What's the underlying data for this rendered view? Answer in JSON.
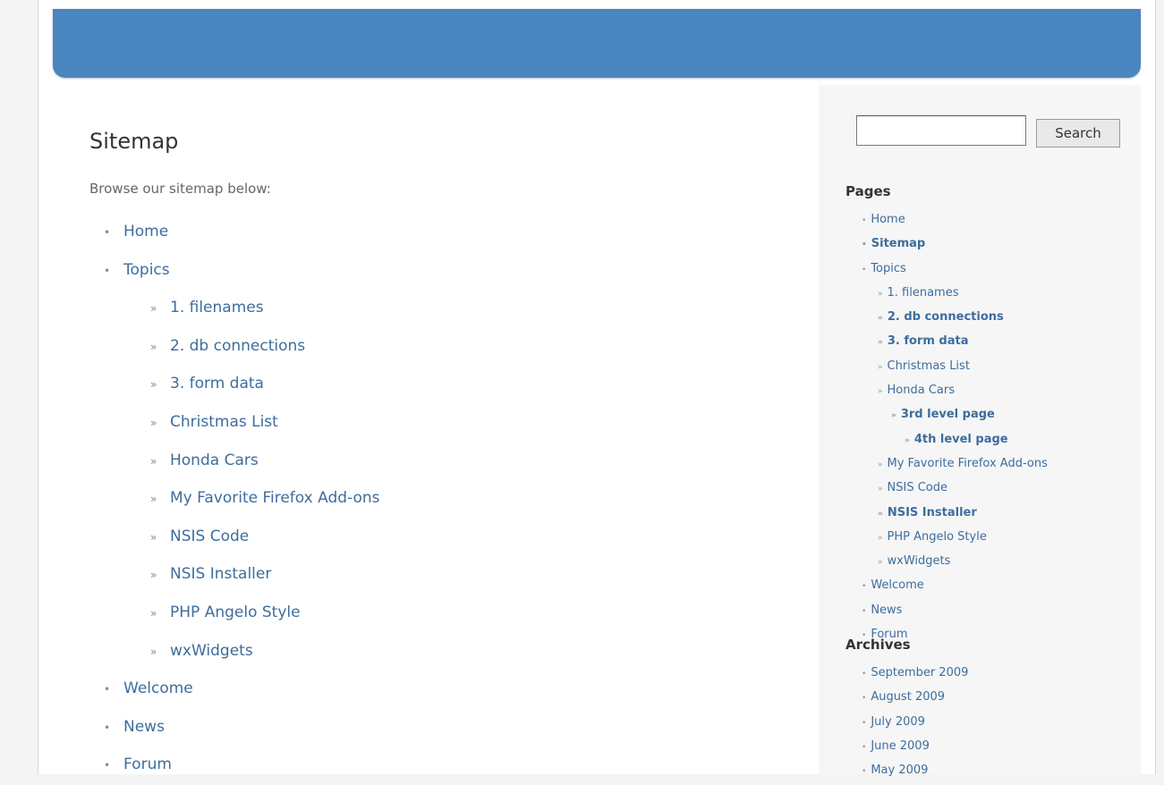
{
  "page": {
    "title": "Sitemap",
    "intro": "Browse our sitemap below:"
  },
  "search": {
    "value": "",
    "button_label": "Search"
  },
  "sitemap": {
    "top": [
      "Home",
      "Topics"
    ],
    "topics_children": [
      "1. filenames",
      "2. db connections",
      "3. form data",
      "Christmas List",
      "Honda Cars",
      "My Favorite Firefox Add-ons",
      "NSIS Code",
      "NSIS Installer",
      "PHP Angelo Style",
      "wxWidgets"
    ],
    "bottom": [
      "Welcome",
      "News",
      "Forum"
    ]
  },
  "sidebar": {
    "pages_title": "Pages",
    "pages": [
      {
        "label": "Home",
        "level": 1
      },
      {
        "label": "Sitemap",
        "level": 1,
        "current": true
      },
      {
        "label": "Topics",
        "level": 1
      },
      {
        "label": "1. filenames",
        "level": 2
      },
      {
        "label": "2. db connections",
        "level": 2
      },
      {
        "label": "3. form data",
        "level": 2
      },
      {
        "label": "Christmas List",
        "level": 2
      },
      {
        "label": "Honda Cars",
        "level": 2
      },
      {
        "label": "3rd level page",
        "level": 3
      },
      {
        "label": "4th level page",
        "level": 4
      },
      {
        "label": "My Favorite Firefox Add-ons",
        "level": 2
      },
      {
        "label": "NSIS Code",
        "level": 2
      },
      {
        "label": "NSIS Installer",
        "level": 2
      },
      {
        "label": "PHP Angelo Style",
        "level": 2
      },
      {
        "label": "wxWidgets",
        "level": 2
      },
      {
        "label": "Welcome",
        "level": 1
      },
      {
        "label": "News",
        "level": 1
      },
      {
        "label": "Forum",
        "level": 1
      }
    ],
    "archives_title": "Archives",
    "archives": [
      "September 2009",
      "August 2009",
      "July 2009",
      "June 2009",
      "May 2009"
    ]
  },
  "colors": {
    "header": "#4a86bf",
    "link": "#3d6d9d"
  }
}
